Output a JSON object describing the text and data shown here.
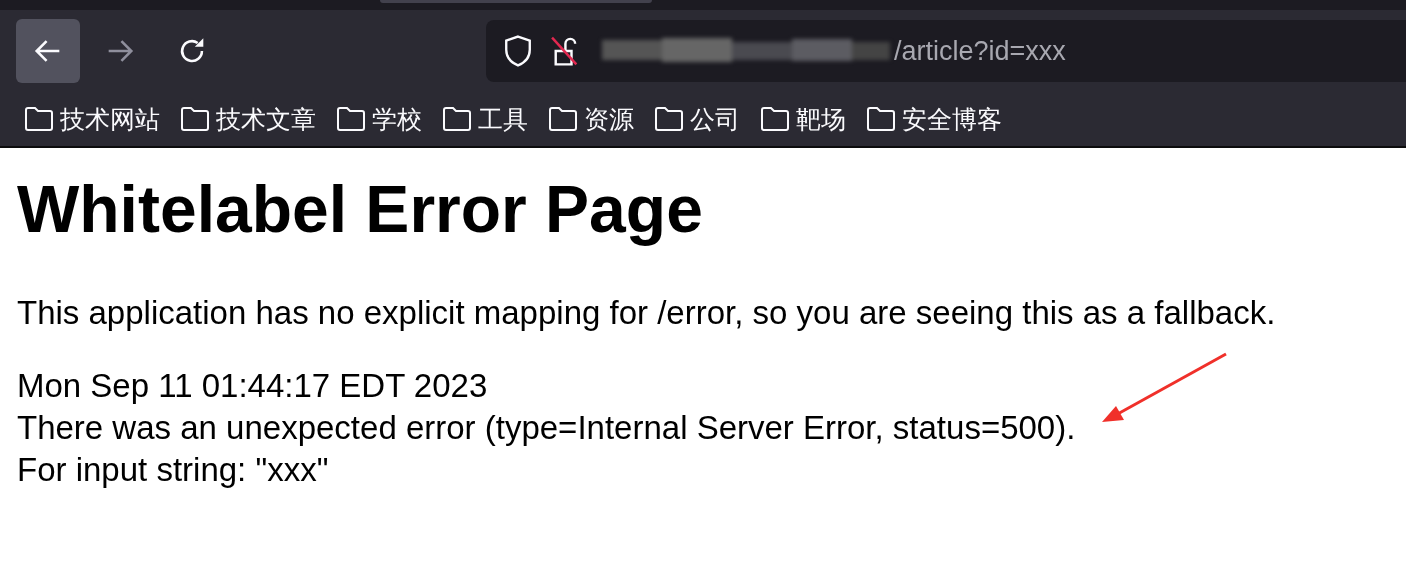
{
  "toolbar": {
    "url": "/article?id=xxx"
  },
  "bookmarks": [
    {
      "label": "技术网站"
    },
    {
      "label": "技术文章"
    },
    {
      "label": "学校"
    },
    {
      "label": "工具"
    },
    {
      "label": "资源"
    },
    {
      "label": "公司"
    },
    {
      "label": "靶场"
    },
    {
      "label": "安全博客"
    }
  ],
  "page": {
    "heading": "Whitelabel Error Page",
    "message": "This application has no explicit mapping for /error, so you are seeing this as a fallback.",
    "details": [
      "Mon Sep 11 01:44:17 EDT 2023",
      "There was an unexpected error (type=Internal Server Error, status=500).",
      "For input string: \"xxx\""
    ]
  }
}
